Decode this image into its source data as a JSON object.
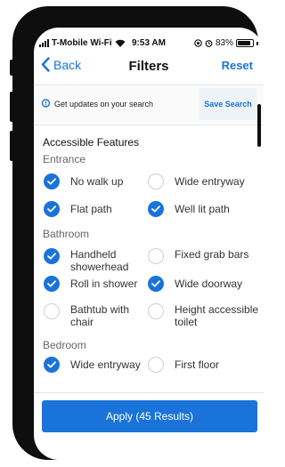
{
  "status_bar": {
    "carrier": "T-Mobile Wi-Fi",
    "time": "9:53 AM",
    "battery": "83%"
  },
  "nav": {
    "back_label": "Back",
    "title": "Filters",
    "reset_label": "Reset"
  },
  "updates": {
    "text": "Get updates on your search",
    "save_label": "Save Search"
  },
  "filters": {
    "section_title": "Accessible Features",
    "groups": [
      {
        "label": "Entrance",
        "options": [
          {
            "label": "No walk up",
            "checked": true
          },
          {
            "label": "Wide entryway",
            "checked": false
          },
          {
            "label": "Flat path",
            "checked": true
          },
          {
            "label": "Well lit path",
            "checked": true
          }
        ]
      },
      {
        "label": "Bathroom",
        "options": [
          {
            "label": "Handheld showerhead",
            "checked": true
          },
          {
            "label": "Fixed grab bars",
            "checked": false
          },
          {
            "label": "Roll in shower",
            "checked": true
          },
          {
            "label": "Wide doorway",
            "checked": true
          },
          {
            "label": "Bathtub with chair",
            "checked": false
          },
          {
            "label": "Height accessible toilet",
            "checked": false
          }
        ]
      },
      {
        "label": "Bedroom",
        "options": [
          {
            "label": "Wide entryway",
            "checked": true
          },
          {
            "label": "First floor",
            "checked": false
          }
        ]
      }
    ]
  },
  "apply": {
    "label": "Apply (45 Results)"
  },
  "colors": {
    "accent": "#1a73d9",
    "frame": "#0e0e0e"
  }
}
